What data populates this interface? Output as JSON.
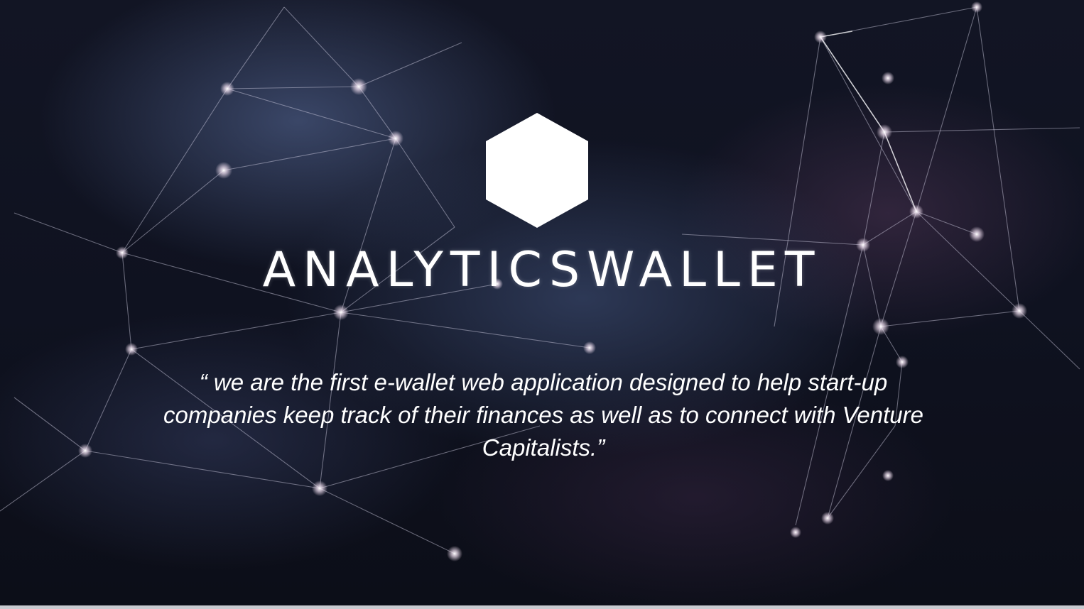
{
  "slide": {
    "brand_name": "ANALYTICSWALLET",
    "tagline": "“ we are the first e-wallet web application designed to help start-up companies keep track of their finances as well as to connect with Venture Capitalists.”"
  },
  "logo": {
    "icon": "hexagon-logo-icon",
    "color": "#ffffff"
  },
  "background": {
    "icon": "network-constellation-graphic",
    "line_color": "#d8d4e8",
    "node_color": "#f3e6f2",
    "base_color": "#0f1220"
  }
}
